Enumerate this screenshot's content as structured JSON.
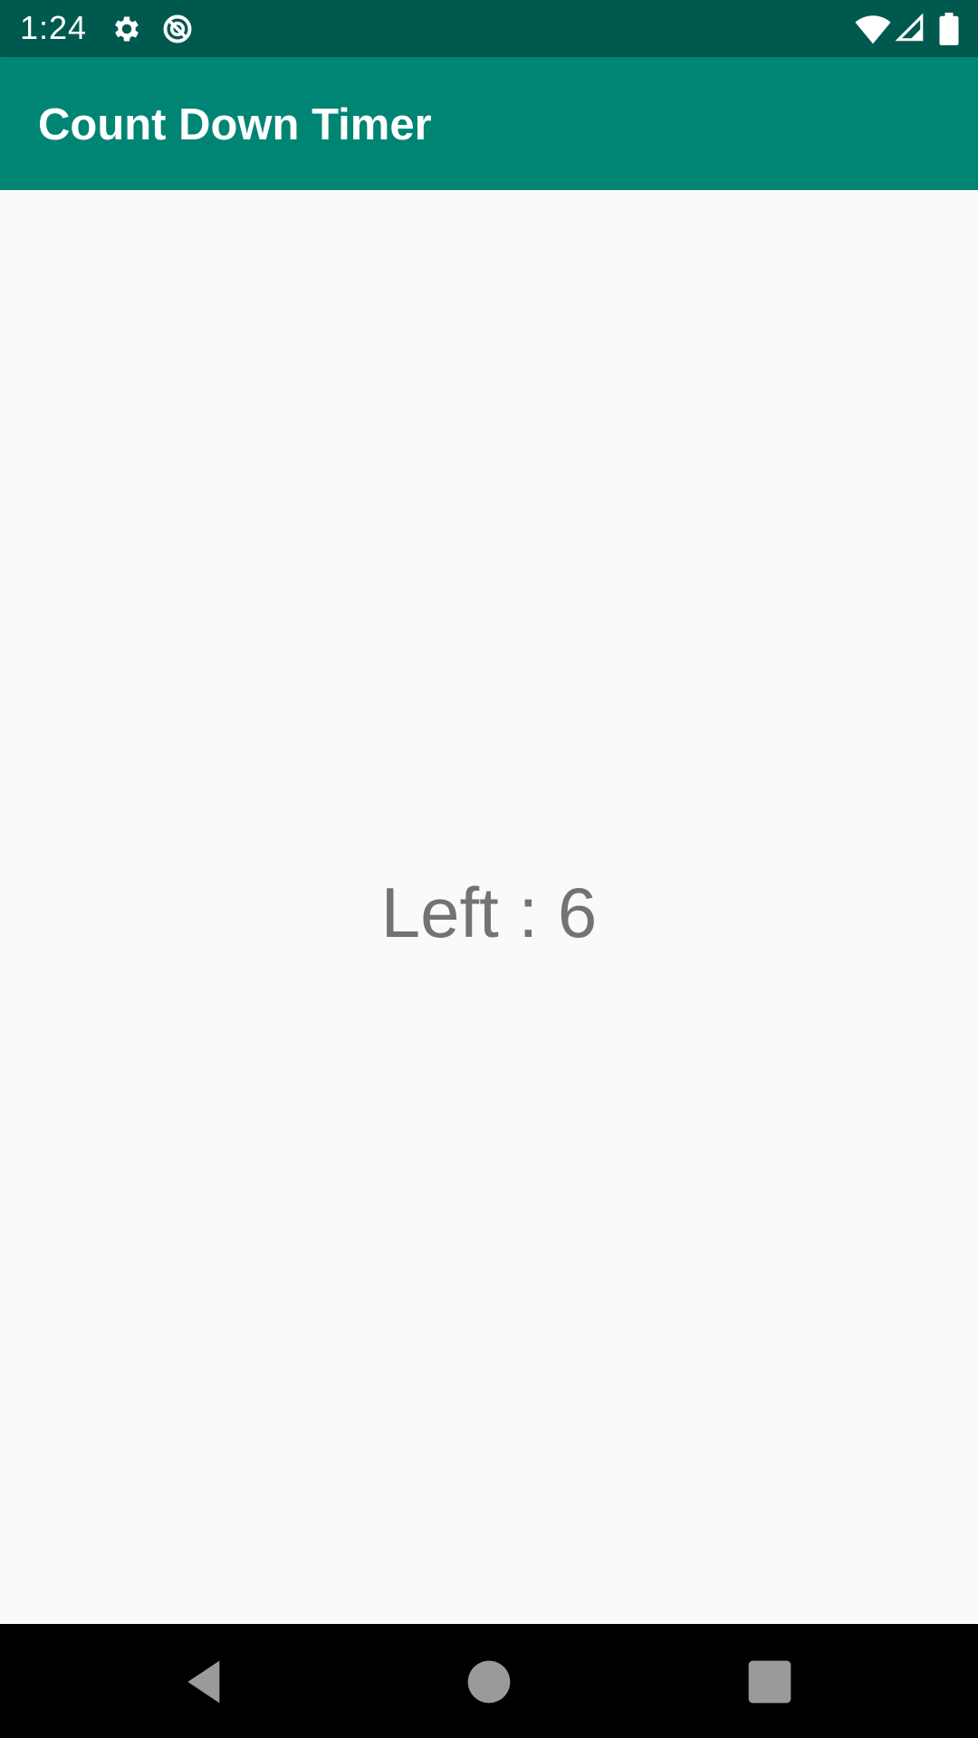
{
  "status_bar": {
    "time": "1:24",
    "icons_left": [
      "gear-icon",
      "do-not-disturb-icon"
    ],
    "icons_right": [
      "wifi-icon",
      "cellular-signal-icon",
      "battery-icon"
    ],
    "color": "#00594f"
  },
  "app_bar": {
    "title": "Count Down Timer",
    "color": "#008574"
  },
  "main": {
    "counter_text": "Left : 6"
  },
  "nav_bar": {
    "buttons": [
      "back-icon",
      "home-icon",
      "recents-icon"
    ]
  }
}
